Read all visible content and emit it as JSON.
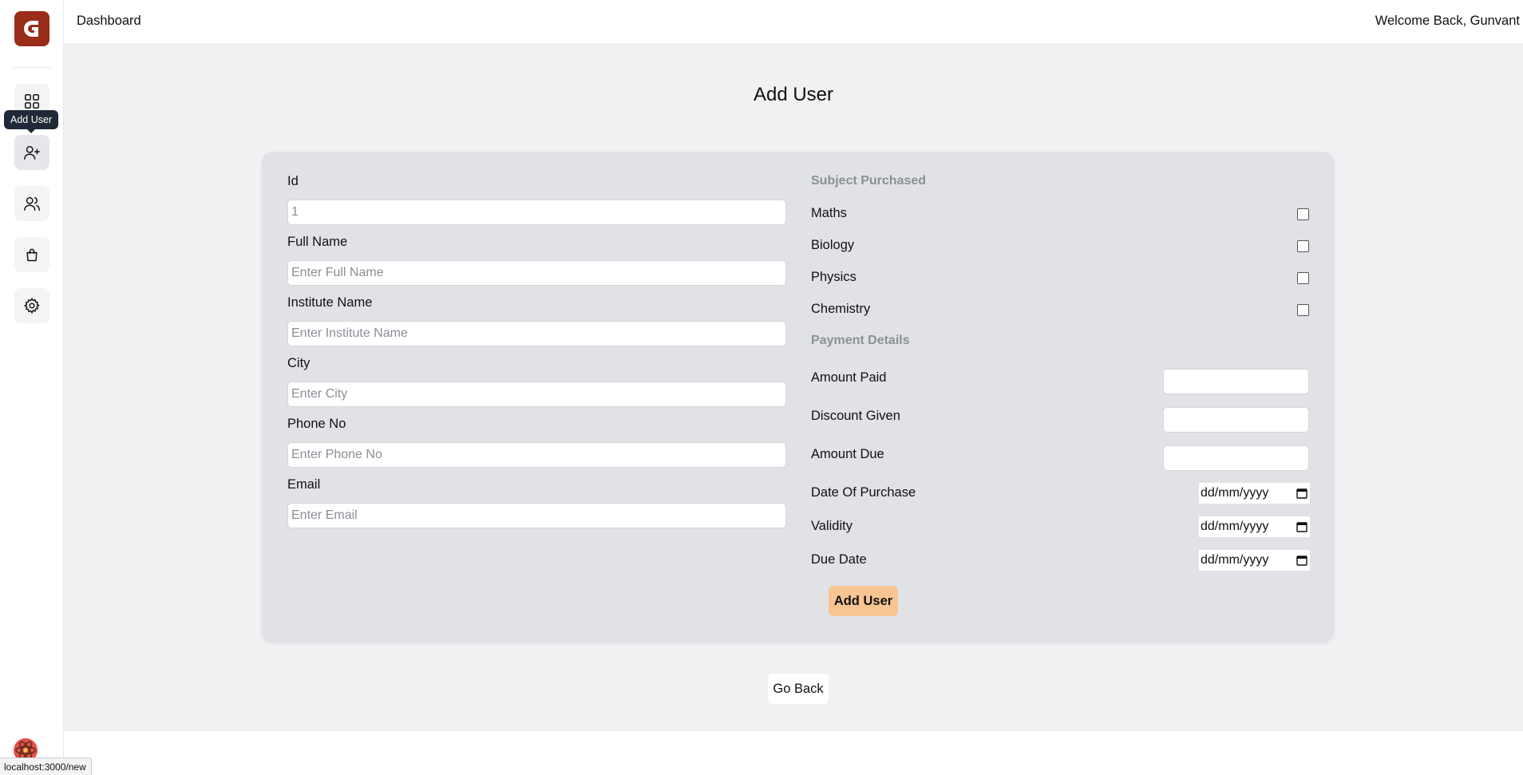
{
  "app": {
    "logo_alt": "G"
  },
  "sidebar": {
    "items": [
      {
        "icon": "grid-icon",
        "label": "Dashboard"
      },
      {
        "icon": "user-plus-icon",
        "label": "Add User"
      },
      {
        "icon": "users-icon",
        "label": "Users"
      },
      {
        "icon": "shopping-bag-icon",
        "label": "Products"
      },
      {
        "icon": "gear-icon",
        "label": "Settings"
      }
    ],
    "tooltip": "Add User"
  },
  "header": {
    "title": "Dashboard",
    "welcome": "Welcome Back, Gunvant"
  },
  "page": {
    "title": "Add User"
  },
  "form": {
    "left_fields": [
      {
        "label": "Id",
        "placeholder": "1"
      },
      {
        "label": "Full Name",
        "placeholder": "Enter Full Name"
      },
      {
        "label": "Institute Name",
        "placeholder": "Enter Institute Name"
      },
      {
        "label": "City",
        "placeholder": "Enter City"
      },
      {
        "label": "Phone No",
        "placeholder": "Enter Phone No"
      },
      {
        "label": "Email",
        "placeholder": "Enter Email"
      }
    ],
    "subjects_heading": "Subject Purchased",
    "subjects": [
      "Maths",
      "Biology",
      "Physics",
      "Chemistry"
    ],
    "payment_heading": "Payment Details",
    "payment_fields": [
      "Amount Paid",
      "Discount Given",
      "Amount Due"
    ],
    "date_fields": [
      {
        "label": "Date Of Purchase",
        "value": "dd/mm/yyyy"
      },
      {
        "label": "Validity",
        "value": "dd/mm/yyyy"
      },
      {
        "label": "Due Date",
        "value": "dd/mm/yyyy"
      }
    ],
    "submit_label": "Add User"
  },
  "go_back_label": "Go Back",
  "status_bar": {
    "url": "localhost:3000/new"
  },
  "colors": {
    "logo_bg": "#9a2c1a",
    "submit_bg": "#f8c592",
    "card_bg": "#e1e2e6",
    "main_bg": "#f0f1f3"
  }
}
